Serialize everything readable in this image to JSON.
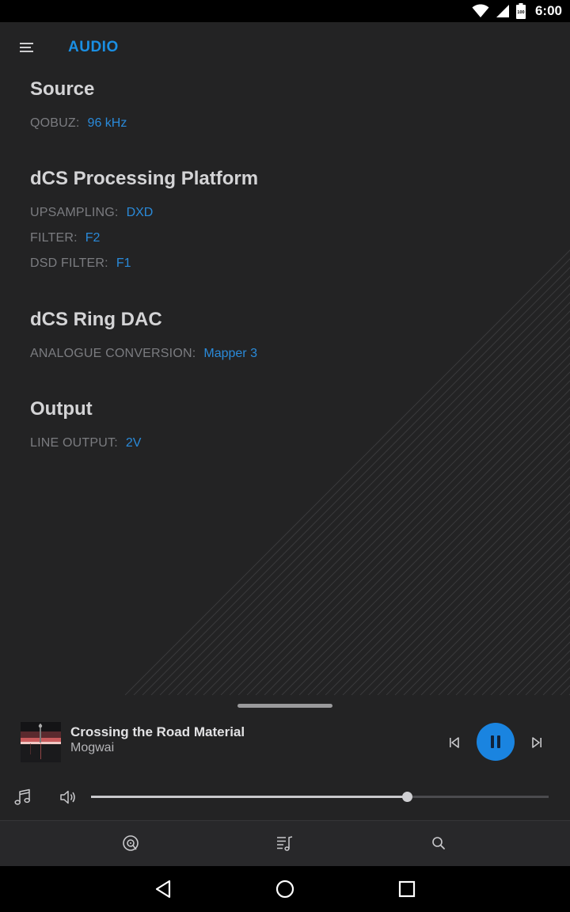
{
  "status_bar": {
    "time": "6:00",
    "battery_level": "100"
  },
  "app_bar": {
    "title": "AUDIO",
    "menu_icon": "hamburger-menu-icon"
  },
  "sections": [
    {
      "heading": "Source",
      "rows": [
        {
          "key": "QOBUZ:",
          "value": "96 kHz"
        }
      ]
    },
    {
      "heading": "dCS Processing Platform",
      "rows": [
        {
          "key": "UPSAMPLING:",
          "value": "DXD"
        },
        {
          "key": "FILTER:",
          "value": "F2"
        },
        {
          "key": "DSD FILTER:",
          "value": "F1"
        }
      ]
    },
    {
      "heading": "dCS Ring DAC",
      "rows": [
        {
          "key": "ANALOGUE CONVERSION:",
          "value": "Mapper 3"
        }
      ]
    },
    {
      "heading": "Output",
      "rows": [
        {
          "key": "LINE OUTPUT:",
          "value": "2V"
        }
      ]
    }
  ],
  "now_playing": {
    "track_title": "Crossing the Road Material",
    "artist": "Mogwai",
    "state": "playing",
    "volume_fraction": 0.69
  },
  "bottom_nav": {
    "items": [
      "now-playing-disc-icon",
      "queue-icon",
      "search-icon"
    ]
  },
  "colors": {
    "accent": "#1a84e0",
    "background": "#232324",
    "label": "#7b7c80",
    "value": "#2a8ad9"
  }
}
